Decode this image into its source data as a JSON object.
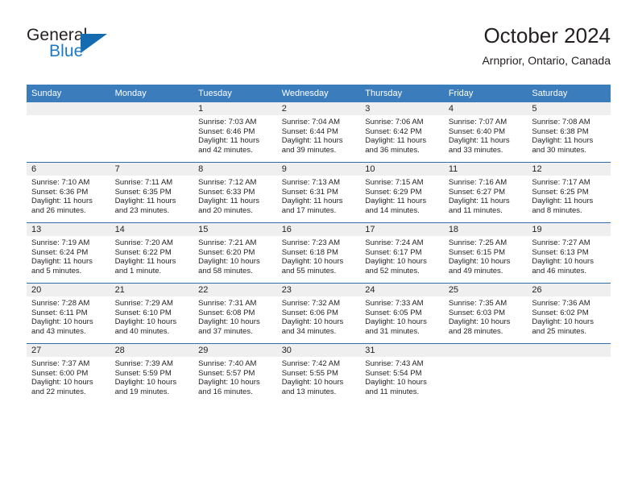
{
  "brand": {
    "name_top": "General",
    "name_bottom": "Blue",
    "color_text": "#231f20",
    "color_blue": "#1f7ac4",
    "triangle_color": "#156bb0"
  },
  "header": {
    "title": "October 2024",
    "subtitle": "Arnprior, Ontario, Canada"
  },
  "theme": {
    "header_blue": "#3b7cbd",
    "row_rule_blue": "#2f6fad",
    "daynum_band": "#efefef",
    "text": "#231f20"
  },
  "weekday_headers": [
    "Sunday",
    "Monday",
    "Tuesday",
    "Wednesday",
    "Thursday",
    "Friday",
    "Saturday"
  ],
  "labels": {
    "sunrise_prefix": "Sunrise:",
    "sunset_prefix": "Sunset:",
    "daylight_prefix": "Daylight:"
  },
  "weeks": [
    [
      {
        "day": "",
        "sunrise": "",
        "sunset": "",
        "daylight_line1": "",
        "daylight_line2": ""
      },
      {
        "day": "",
        "sunrise": "",
        "sunset": "",
        "daylight_line1": "",
        "daylight_line2": ""
      },
      {
        "day": "1",
        "sunrise": "Sunrise: 7:03 AM",
        "sunset": "Sunset: 6:46 PM",
        "daylight_line1": "Daylight: 11 hours",
        "daylight_line2": "and 42 minutes."
      },
      {
        "day": "2",
        "sunrise": "Sunrise: 7:04 AM",
        "sunset": "Sunset: 6:44 PM",
        "daylight_line1": "Daylight: 11 hours",
        "daylight_line2": "and 39 minutes."
      },
      {
        "day": "3",
        "sunrise": "Sunrise: 7:06 AM",
        "sunset": "Sunset: 6:42 PM",
        "daylight_line1": "Daylight: 11 hours",
        "daylight_line2": "and 36 minutes."
      },
      {
        "day": "4",
        "sunrise": "Sunrise: 7:07 AM",
        "sunset": "Sunset: 6:40 PM",
        "daylight_line1": "Daylight: 11 hours",
        "daylight_line2": "and 33 minutes."
      },
      {
        "day": "5",
        "sunrise": "Sunrise: 7:08 AM",
        "sunset": "Sunset: 6:38 PM",
        "daylight_line1": "Daylight: 11 hours",
        "daylight_line2": "and 30 minutes."
      }
    ],
    [
      {
        "day": "6",
        "sunrise": "Sunrise: 7:10 AM",
        "sunset": "Sunset: 6:36 PM",
        "daylight_line1": "Daylight: 11 hours",
        "daylight_line2": "and 26 minutes."
      },
      {
        "day": "7",
        "sunrise": "Sunrise: 7:11 AM",
        "sunset": "Sunset: 6:35 PM",
        "daylight_line1": "Daylight: 11 hours",
        "daylight_line2": "and 23 minutes."
      },
      {
        "day": "8",
        "sunrise": "Sunrise: 7:12 AM",
        "sunset": "Sunset: 6:33 PM",
        "daylight_line1": "Daylight: 11 hours",
        "daylight_line2": "and 20 minutes."
      },
      {
        "day": "9",
        "sunrise": "Sunrise: 7:13 AM",
        "sunset": "Sunset: 6:31 PM",
        "daylight_line1": "Daylight: 11 hours",
        "daylight_line2": "and 17 minutes."
      },
      {
        "day": "10",
        "sunrise": "Sunrise: 7:15 AM",
        "sunset": "Sunset: 6:29 PM",
        "daylight_line1": "Daylight: 11 hours",
        "daylight_line2": "and 14 minutes."
      },
      {
        "day": "11",
        "sunrise": "Sunrise: 7:16 AM",
        "sunset": "Sunset: 6:27 PM",
        "daylight_line1": "Daylight: 11 hours",
        "daylight_line2": "and 11 minutes."
      },
      {
        "day": "12",
        "sunrise": "Sunrise: 7:17 AM",
        "sunset": "Sunset: 6:25 PM",
        "daylight_line1": "Daylight: 11 hours",
        "daylight_line2": "and 8 minutes."
      }
    ],
    [
      {
        "day": "13",
        "sunrise": "Sunrise: 7:19 AM",
        "sunset": "Sunset: 6:24 PM",
        "daylight_line1": "Daylight: 11 hours",
        "daylight_line2": "and 5 minutes."
      },
      {
        "day": "14",
        "sunrise": "Sunrise: 7:20 AM",
        "sunset": "Sunset: 6:22 PM",
        "daylight_line1": "Daylight: 11 hours",
        "daylight_line2": "and 1 minute."
      },
      {
        "day": "15",
        "sunrise": "Sunrise: 7:21 AM",
        "sunset": "Sunset: 6:20 PM",
        "daylight_line1": "Daylight: 10 hours",
        "daylight_line2": "and 58 minutes."
      },
      {
        "day": "16",
        "sunrise": "Sunrise: 7:23 AM",
        "sunset": "Sunset: 6:18 PM",
        "daylight_line1": "Daylight: 10 hours",
        "daylight_line2": "and 55 minutes."
      },
      {
        "day": "17",
        "sunrise": "Sunrise: 7:24 AM",
        "sunset": "Sunset: 6:17 PM",
        "daylight_line1": "Daylight: 10 hours",
        "daylight_line2": "and 52 minutes."
      },
      {
        "day": "18",
        "sunrise": "Sunrise: 7:25 AM",
        "sunset": "Sunset: 6:15 PM",
        "daylight_line1": "Daylight: 10 hours",
        "daylight_line2": "and 49 minutes."
      },
      {
        "day": "19",
        "sunrise": "Sunrise: 7:27 AM",
        "sunset": "Sunset: 6:13 PM",
        "daylight_line1": "Daylight: 10 hours",
        "daylight_line2": "and 46 minutes."
      }
    ],
    [
      {
        "day": "20",
        "sunrise": "Sunrise: 7:28 AM",
        "sunset": "Sunset: 6:11 PM",
        "daylight_line1": "Daylight: 10 hours",
        "daylight_line2": "and 43 minutes."
      },
      {
        "day": "21",
        "sunrise": "Sunrise: 7:29 AM",
        "sunset": "Sunset: 6:10 PM",
        "daylight_line1": "Daylight: 10 hours",
        "daylight_line2": "and 40 minutes."
      },
      {
        "day": "22",
        "sunrise": "Sunrise: 7:31 AM",
        "sunset": "Sunset: 6:08 PM",
        "daylight_line1": "Daylight: 10 hours",
        "daylight_line2": "and 37 minutes."
      },
      {
        "day": "23",
        "sunrise": "Sunrise: 7:32 AM",
        "sunset": "Sunset: 6:06 PM",
        "daylight_line1": "Daylight: 10 hours",
        "daylight_line2": "and 34 minutes."
      },
      {
        "day": "24",
        "sunrise": "Sunrise: 7:33 AM",
        "sunset": "Sunset: 6:05 PM",
        "daylight_line1": "Daylight: 10 hours",
        "daylight_line2": "and 31 minutes."
      },
      {
        "day": "25",
        "sunrise": "Sunrise: 7:35 AM",
        "sunset": "Sunset: 6:03 PM",
        "daylight_line1": "Daylight: 10 hours",
        "daylight_line2": "and 28 minutes."
      },
      {
        "day": "26",
        "sunrise": "Sunrise: 7:36 AM",
        "sunset": "Sunset: 6:02 PM",
        "daylight_line1": "Daylight: 10 hours",
        "daylight_line2": "and 25 minutes."
      }
    ],
    [
      {
        "day": "27",
        "sunrise": "Sunrise: 7:37 AM",
        "sunset": "Sunset: 6:00 PM",
        "daylight_line1": "Daylight: 10 hours",
        "daylight_line2": "and 22 minutes."
      },
      {
        "day": "28",
        "sunrise": "Sunrise: 7:39 AM",
        "sunset": "Sunset: 5:59 PM",
        "daylight_line1": "Daylight: 10 hours",
        "daylight_line2": "and 19 minutes."
      },
      {
        "day": "29",
        "sunrise": "Sunrise: 7:40 AM",
        "sunset": "Sunset: 5:57 PM",
        "daylight_line1": "Daylight: 10 hours",
        "daylight_line2": "and 16 minutes."
      },
      {
        "day": "30",
        "sunrise": "Sunrise: 7:42 AM",
        "sunset": "Sunset: 5:55 PM",
        "daylight_line1": "Daylight: 10 hours",
        "daylight_line2": "and 13 minutes."
      },
      {
        "day": "31",
        "sunrise": "Sunrise: 7:43 AM",
        "sunset": "Sunset: 5:54 PM",
        "daylight_line1": "Daylight: 10 hours",
        "daylight_line2": "and 11 minutes."
      },
      {
        "day": "",
        "sunrise": "",
        "sunset": "",
        "daylight_line1": "",
        "daylight_line2": ""
      },
      {
        "day": "",
        "sunrise": "",
        "sunset": "",
        "daylight_line1": "",
        "daylight_line2": ""
      }
    ]
  ]
}
